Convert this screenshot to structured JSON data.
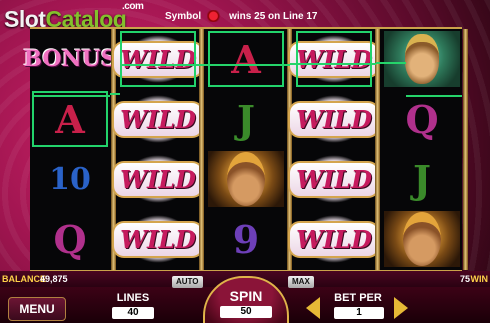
{
  "watermark": {
    "slot": "Slot",
    "catalog": "Catalog",
    "com": ".com"
  },
  "top_message": {
    "left": "Symbol",
    "right": "wins 25 on Line 17"
  },
  "reels": [
    [
      {
        "type": "bonus",
        "text": "BONUS"
      },
      {
        "type": "letter",
        "text": "A",
        "cls": "a",
        "hl": true
      },
      {
        "type": "letter",
        "text": "10",
        "cls": "ten"
      },
      {
        "type": "letter",
        "text": "Q",
        "cls": "q"
      }
    ],
    [
      {
        "type": "wild",
        "text": "WILD",
        "hl": true
      },
      {
        "type": "wild",
        "text": "WILD"
      },
      {
        "type": "wild",
        "text": "WILD"
      },
      {
        "type": "wild",
        "text": "WILD"
      }
    ],
    [
      {
        "type": "letter",
        "text": "A",
        "cls": "a",
        "hl": true
      },
      {
        "type": "letter",
        "text": "J",
        "cls": "j"
      },
      {
        "type": "face"
      },
      {
        "type": "letter",
        "text": "9",
        "cls": "nine"
      }
    ],
    [
      {
        "type": "wild",
        "text": "WILD",
        "hl": true
      },
      {
        "type": "wild",
        "text": "WILD"
      },
      {
        "type": "wild",
        "text": "WILD"
      },
      {
        "type": "wild",
        "text": "WILD"
      }
    ],
    [
      {
        "type": "lady"
      },
      {
        "type": "letter",
        "text": "Q",
        "cls": "q"
      },
      {
        "type": "letter",
        "text": "J",
        "cls": "j"
      },
      {
        "type": "face"
      }
    ]
  ],
  "balance": {
    "label": "BALANCE",
    "value": "49,875",
    "win_value": "75",
    "win_label": "WIN"
  },
  "controls": {
    "menu": "MENU",
    "lines_label": "LINES",
    "lines_value": "40",
    "auto": "AUTO",
    "max": "MAX",
    "spin": "SPIN",
    "spin_value": "50",
    "bet_label": "BET PER",
    "bet_value": "1"
  },
  "colors": {
    "payline": "#25d46a",
    "accent_gold": "#e6b936"
  }
}
